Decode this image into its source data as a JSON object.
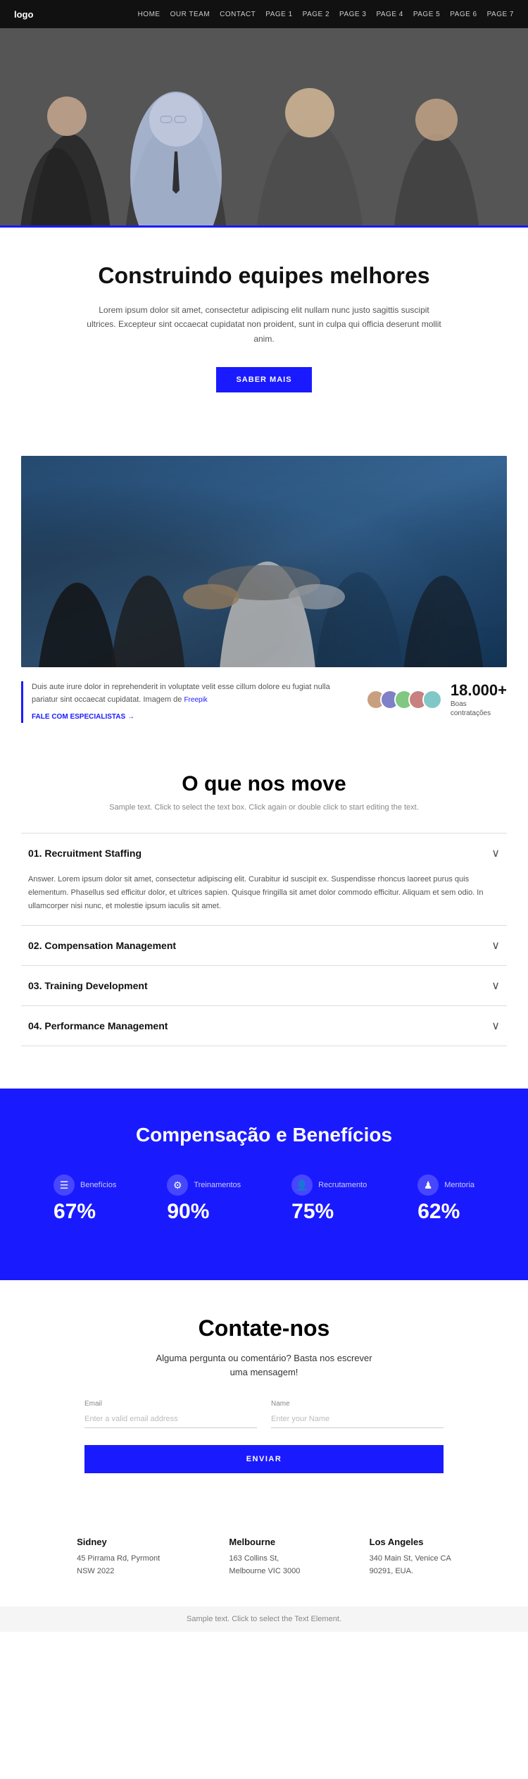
{
  "nav": {
    "logo": "logo",
    "links": [
      "HOME",
      "OUR TEAM",
      "CONTACT",
      "PAGE 1",
      "PAGE 2",
      "PAGE 3",
      "PAGE 4",
      "PAGE 5",
      "PAGE 6",
      "PAGE 7"
    ]
  },
  "hero": {
    "alt": "Business team photo"
  },
  "construindo": {
    "heading": "Construindo equipes melhores",
    "body": "Lorem ipsum dolor sit amet, consectetur adipiscing elit nullam nunc justo sagittis suscipit ultrices. Excepteur sint occaecat cupidatat non proident, sunt in culpa qui officia deserunt mollit anim.",
    "button": "SABER MAIS"
  },
  "stats": {
    "text": "Duis aute irure dolor in reprehenderit in voluptate velit esse cillum dolore eu fugiat nulla pariatur sint occaecat cupidatat. Imagem de ",
    "freepik": "Freepik",
    "link": "FALE COM ESPECIALISTAS →",
    "number": "18.000+",
    "label": "Boas\ncontratações"
  },
  "move": {
    "heading": "O que nos move",
    "subtitle": "Sample text. Click to select the text box. Click again or double click to start editing the text."
  },
  "accordion": [
    {
      "id": "acc1",
      "title": "01. Recruitment Staffing",
      "open": true,
      "body": "Answer. Lorem ipsum dolor sit amet, consectetur adipiscing elit. Curabitur id suscipit ex. Suspendisse rhoncus laoreet purus quis elementum. Phasellus sed efficitur dolor, et ultrices sapien. Quisque fringilla sit amet dolor commodo efficitur. Aliquam et sem odio. In ullamcorper nisi nunc, et molestie ipsum iaculis sit amet."
    },
    {
      "id": "acc2",
      "title": "02. Compensation Management",
      "open": false,
      "body": ""
    },
    {
      "id": "acc3",
      "title": "03. Training Development",
      "open": false,
      "body": ""
    },
    {
      "id": "acc4",
      "title": "04. Performance Management",
      "open": false,
      "body": ""
    }
  ],
  "blue_section": {
    "heading": "Compensação e Benefícios",
    "items": [
      {
        "icon": "☰",
        "label": "Benefícios",
        "percent": "67%"
      },
      {
        "icon": "⚙",
        "label": "Treinamentos",
        "percent": "90%"
      },
      {
        "icon": "👤",
        "label": "Recrutamento",
        "percent": "75%"
      },
      {
        "icon": "♟",
        "label": "Mentoria",
        "percent": "62%"
      }
    ]
  },
  "contact": {
    "heading": "Contate-nos",
    "subtext": "Alguma pergunta ou comentário? Basta nos escrever\numa mensagem!",
    "email_label": "Email",
    "email_placeholder": "Enter a valid email address",
    "name_label": "Name",
    "name_placeholder": "Enter your Name",
    "button": "ENVIAR"
  },
  "offices": [
    {
      "city": "Sidney",
      "address": "45 Pirrama Rd, Pyrmont\nNSW 2022"
    },
    {
      "city": "Melbourne",
      "address": "163 Collins St,\nMelbourne VIC 3000"
    },
    {
      "city": "Los Angeles",
      "address": "340 Main St, Venice CA\n90291, EUA."
    }
  ],
  "footer": {
    "hint": "Sample text. Click to select the Text Element."
  }
}
